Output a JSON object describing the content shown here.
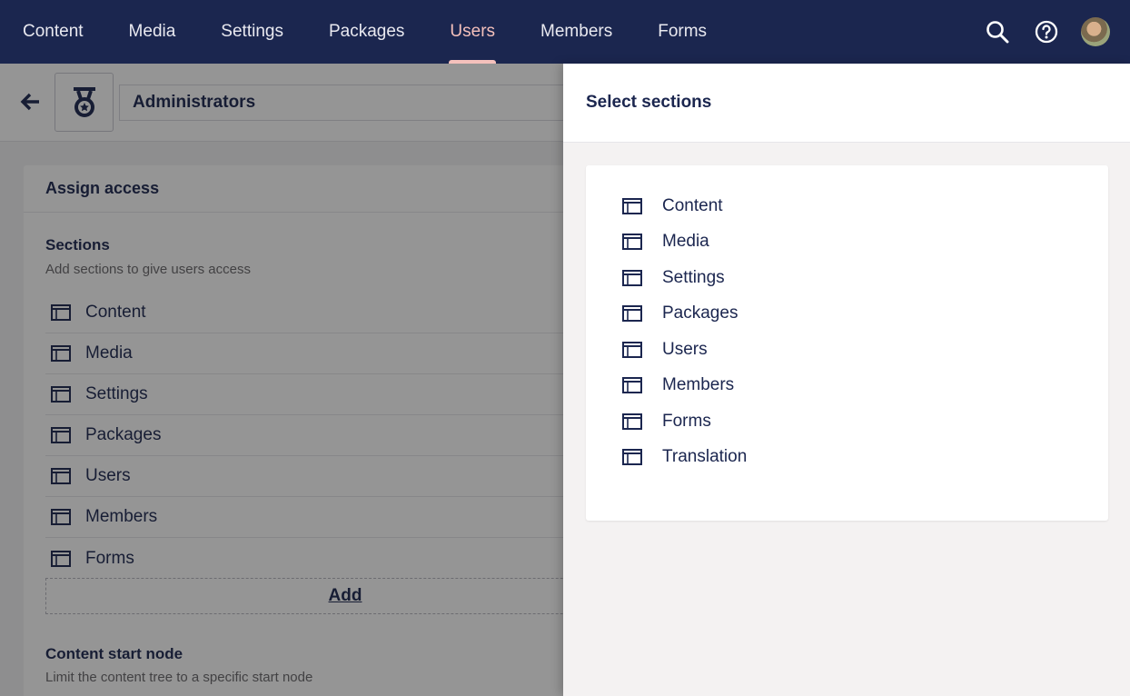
{
  "nav": {
    "items": [
      {
        "label": "Content",
        "active": false
      },
      {
        "label": "Media",
        "active": false
      },
      {
        "label": "Settings",
        "active": false
      },
      {
        "label": "Packages",
        "active": false
      },
      {
        "label": "Users",
        "active": true
      },
      {
        "label": "Members",
        "active": false
      },
      {
        "label": "Forms",
        "active": false
      }
    ],
    "icons": [
      "search-icon",
      "help-icon",
      "avatar"
    ]
  },
  "editor": {
    "group_name": "Administrators",
    "group_icon": "medal-icon",
    "card_title": "Assign access",
    "sections_label": "Sections",
    "sections_desc": "Add sections to give users access",
    "sections": [
      "Content",
      "Media",
      "Settings",
      "Packages",
      "Users",
      "Members",
      "Forms"
    ],
    "add_label": "Add",
    "start_node_label": "Content start node",
    "start_node_desc": "Limit the content tree to a specific start node"
  },
  "panel": {
    "title": "Select sections",
    "items": [
      "Content",
      "Media",
      "Settings",
      "Packages",
      "Users",
      "Members",
      "Forms",
      "Translation"
    ]
  },
  "colors": {
    "topbar": "#1b264f",
    "active_nav": "#f5c1bc",
    "text": "#1b264f",
    "panel_bg": "#f4f2f2"
  }
}
